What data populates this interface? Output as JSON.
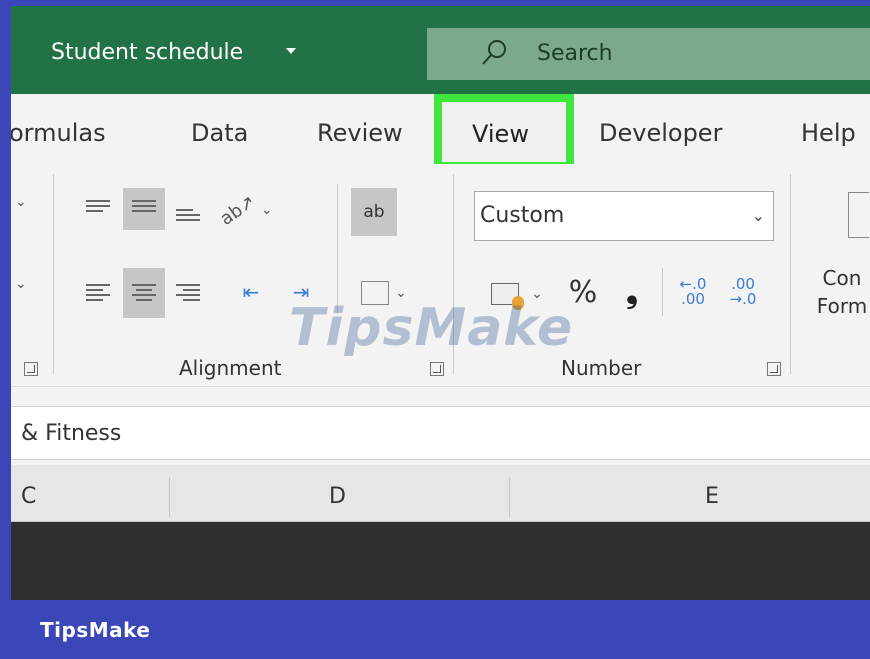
{
  "window": {
    "title": "Student schedule",
    "search_label": "Search"
  },
  "tabs": [
    {
      "label": "ormulas"
    },
    {
      "label": "Data"
    },
    {
      "label": "Review"
    },
    {
      "label": "View",
      "highlighted": true
    },
    {
      "label": "Developer"
    },
    {
      "label": "Help"
    }
  ],
  "ribbon": {
    "alignment_label": "Alignment",
    "number_label": "Number",
    "number_format_value": "Custom",
    "percent_symbol": "%",
    "comma_symbol": "❟",
    "wrap_text_symbol": "ab",
    "cond_format_line1": "Con",
    "cond_format_line2": "Form"
  },
  "formula_bar": {
    "content": "& Fitness"
  },
  "columns": [
    "C",
    "D",
    "E"
  ],
  "watermark": "TipsMake",
  "footer": {
    "brand": "TipsMake"
  },
  "colors": {
    "title_bar": "#217346",
    "highlight_box": "#3ee63e",
    "frame": "#3b46b8"
  }
}
